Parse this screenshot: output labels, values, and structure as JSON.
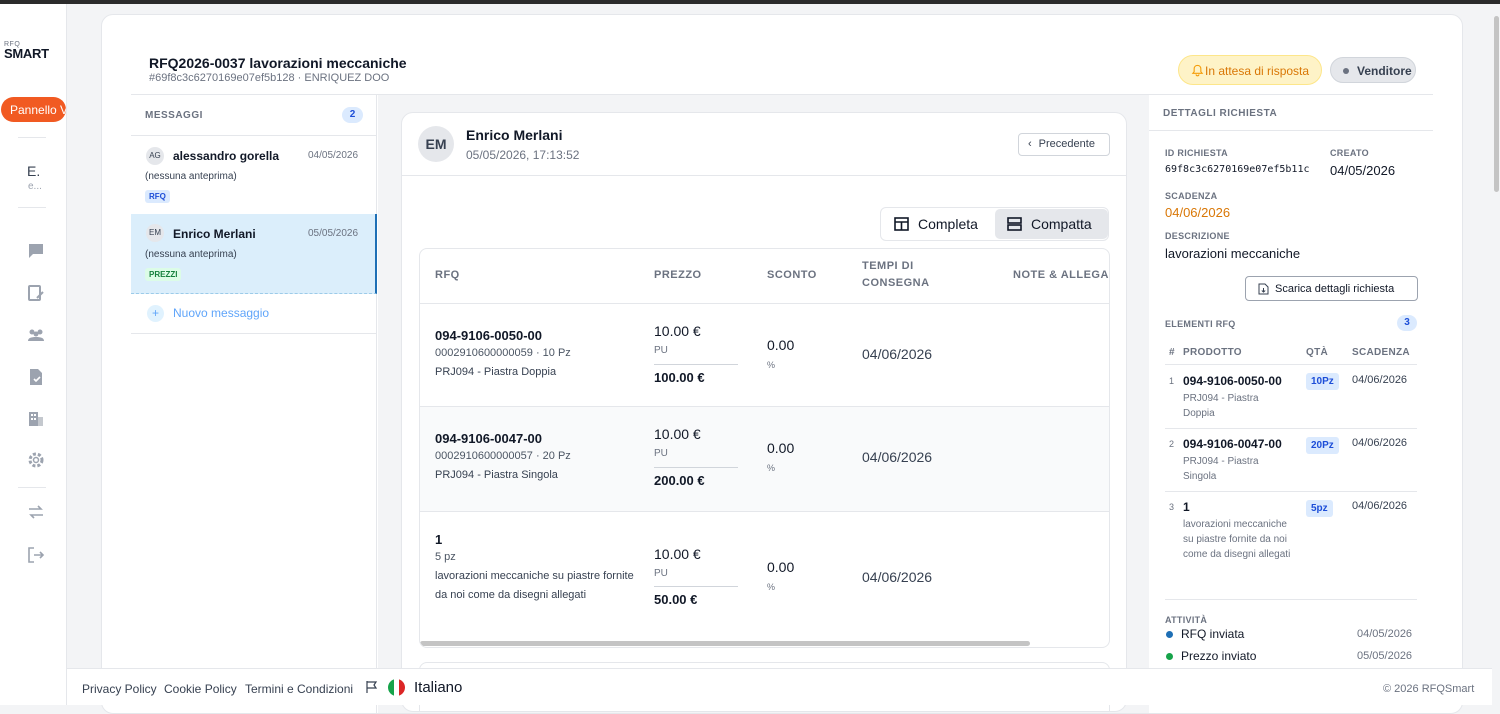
{
  "sidebar": {
    "logo_small": "RFQ",
    "logo_big": "SMART",
    "nav_pill": "Pannello V",
    "user_initial": "E.",
    "user_sub": "e..."
  },
  "header": {
    "title": "RFQ2026-0037 lavorazioni meccaniche",
    "subtitle": "#69f8c3c6270169e07ef5b128 · ENRIQUEZ DOO",
    "status": "In attesa di risposta",
    "role": "Venditore"
  },
  "messages": {
    "heading": "MESSAGGI",
    "count": "2",
    "items": [
      {
        "initials": "AG",
        "name": "alessandro gorella",
        "date": "04/05/2026",
        "preview": "(nessuna anteprima)",
        "tag": "RFQ"
      },
      {
        "initials": "EM",
        "name": "Enrico Merlani",
        "date": "05/05/2026",
        "preview": "(nessuna anteprima)",
        "tag": "PREZZI"
      }
    ],
    "new_label": "Nuovo messaggio"
  },
  "detail": {
    "initials": "EM",
    "sender": "Enrico Merlani",
    "sent_at": "05/05/2026, 17:13:52",
    "prev_button": "Precedente",
    "view_full": "Completa",
    "view_compact": "Compatta",
    "columns": [
      "RFQ",
      "PREZZO",
      "SCONTO",
      "TEMPI DI CONSEGNA",
      "NOTE & ALLEGA"
    ],
    "rows": [
      {
        "code": "094-9106-0050-00",
        "sub": "0002910600000059 · 10 Pz",
        "desc": "PRJ094 - Piastra Doppia",
        "price": "10.00 €",
        "unit": "PU",
        "total": "100.00 €",
        "discount": "0.00",
        "pct": "%",
        "date": "04/06/2026"
      },
      {
        "code": "094-9106-0047-00",
        "sub": "0002910600000057 · 20 Pz",
        "desc": "PRJ094 - Piastra Singola",
        "price": "10.00 €",
        "unit": "PU",
        "total": "200.00 €",
        "discount": "0.00",
        "pct": "%",
        "date": "04/06/2026"
      },
      {
        "code": "1",
        "sub": "5 pz",
        "desc": "lavorazioni meccaniche su piastre fornite da noi come da disegni allegati",
        "price": "10.00 €",
        "unit": "PU",
        "total": "50.00 €",
        "discount": "0.00",
        "pct": "%",
        "date": "04/06/2026"
      }
    ]
  },
  "request": {
    "heading": "DETTAGLI RICHIESTA",
    "id_label": "ID RICHIESTA",
    "id_value": "69f8c3c6270169e07ef5b11c",
    "created_label": "CREATO",
    "created_value": "04/05/2026",
    "deadline_label": "SCADENZA",
    "deadline_value": "04/06/2026",
    "desc_label": "DESCRIZIONE",
    "desc_value": "lavorazioni meccaniche",
    "download_button": "Scarica dettagli richiesta",
    "items_label": "ELEMENTI RFQ",
    "items_count": "3",
    "items_columns": [
      "#",
      "PRODOTTO",
      "QTÀ",
      "SCADENZA"
    ],
    "items": [
      {
        "n": "1",
        "code": "094-9106-0050-00",
        "desc": "PRJ094 - Piastra Doppia",
        "qty": "10Pz",
        "date": "04/06/2026"
      },
      {
        "n": "2",
        "code": "094-9106-0047-00",
        "desc": "PRJ094 - Piastra Singola",
        "qty": "20Pz",
        "date": "04/06/2026"
      },
      {
        "n": "3",
        "code": "1",
        "desc": "lavorazioni meccaniche su piastre fornite da noi come da disegni allegati",
        "qty": "5pz",
        "date": "04/06/2026"
      }
    ],
    "activity_label": "ATTIVITÀ",
    "activity": [
      {
        "text": "RFQ inviata",
        "date": "04/05/2026",
        "color": "#1e6fb5"
      },
      {
        "text": "Prezzo inviato",
        "date": "05/05/2026",
        "color": "#16a34a"
      }
    ]
  },
  "footer": {
    "privacy": "Privacy Policy",
    "cookie": "Cookie Policy",
    "terms": "Termini e Condizioni",
    "language": "Italiano",
    "copyright": "© 2026 RFQSmart"
  },
  "colors": {
    "accent": "#f15a22",
    "status": "#d97706",
    "selected": "#dbeefb"
  }
}
